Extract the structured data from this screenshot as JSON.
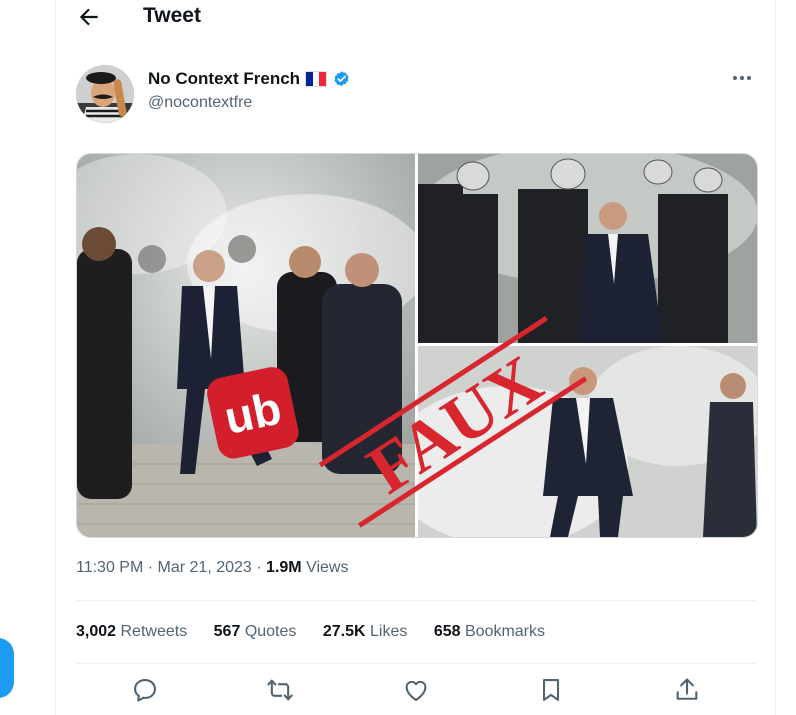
{
  "header": {
    "title": "Tweet",
    "back_icon": "arrow-left-icon"
  },
  "author": {
    "display_name": "No Context French",
    "flag": "🇫🇷",
    "handle": "@nocontextfre",
    "verified": true
  },
  "media": {
    "watermark_text": "FAUX",
    "logo_text": "ub"
  },
  "meta": {
    "time": "11:30 PM",
    "separator": "·",
    "date": "Mar 21, 2023",
    "views_count": "1.9M",
    "views_label": "Views"
  },
  "stats": {
    "retweets_count": "3,002",
    "retweets_label": "Retweets",
    "quotes_count": "567",
    "quotes_label": "Quotes",
    "likes_count": "27.5K",
    "likes_label": "Likes",
    "bookmarks_count": "658",
    "bookmarks_label": "Bookmarks"
  },
  "actions": [
    "reply-icon",
    "retweet-icon",
    "like-icon",
    "bookmark-icon",
    "share-icon"
  ],
  "colors": {
    "accent": "#1d9bf0",
    "text": "#0f1419",
    "muted": "#536471",
    "watermark": "#d8262e"
  }
}
